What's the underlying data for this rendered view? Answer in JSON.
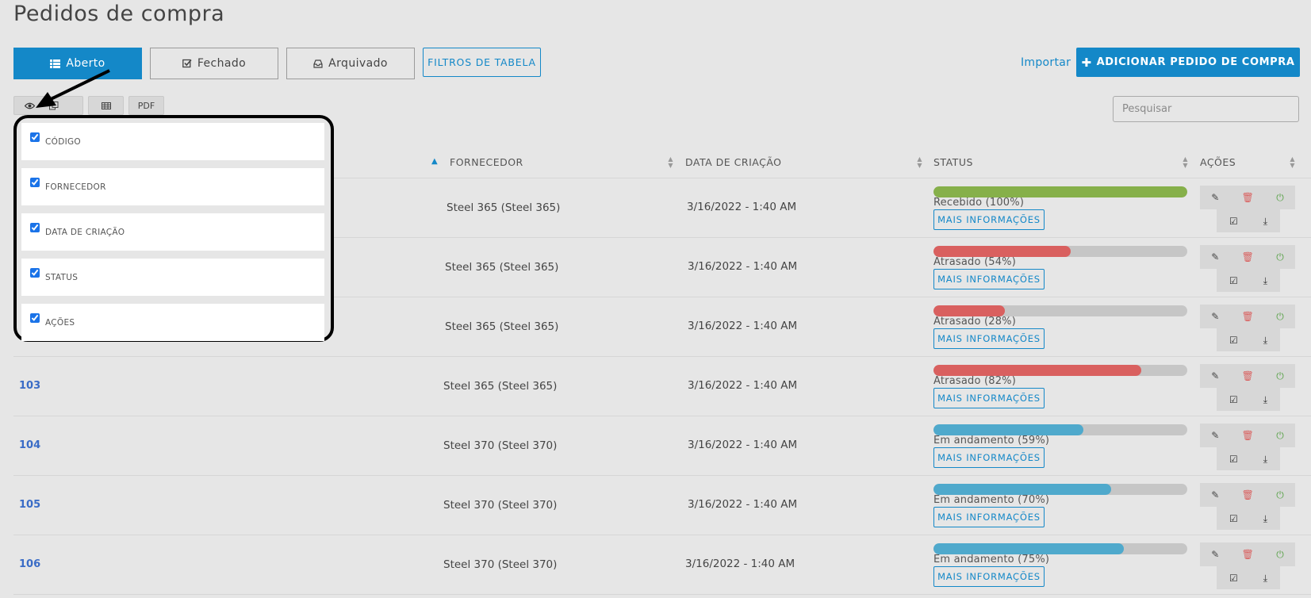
{
  "page": {
    "title": "Pedidos de compra"
  },
  "tabs": [
    {
      "label": "Aberto",
      "icon": "list-icon"
    },
    {
      "label": "Fechado",
      "icon": "check-square-icon"
    },
    {
      "label": "Arquivado",
      "icon": "inbox-icon"
    },
    {
      "label": "FILTROS DE TABELA"
    }
  ],
  "header_actions": {
    "import_label": "Importar",
    "add_label": "ADICIONAR PEDIDO DE COMPRA"
  },
  "toolbar": {
    "pdf_label": "PDF"
  },
  "search": {
    "placeholder": "Pesquisar"
  },
  "columns": {
    "supplier": "FORNECEDOR",
    "created": "DATA DE CRIAÇÃO",
    "status": "STATUS",
    "actions": "AÇÕES"
  },
  "column_chooser": {
    "options": [
      {
        "label": "CÓDIGO",
        "checked": true
      },
      {
        "label": "FORNECEDOR",
        "checked": true
      },
      {
        "label": "DATA DE CRIAÇÃO",
        "checked": true
      },
      {
        "label": "STATUS",
        "checked": true
      },
      {
        "label": "AÇÕES",
        "checked": true
      }
    ]
  },
  "rows": [
    {
      "code": "",
      "supplier": "Steel 365 (Steel 365)",
      "date": "3/16/2022 - 1:40 AM",
      "status": "Recebido (100%)",
      "progress": 100,
      "state": "received",
      "more": "MAIS INFORMAÇÕES"
    },
    {
      "code": "",
      "supplier": "Steel 365 (Steel 365)",
      "date": "3/16/2022 - 1:40 AM",
      "status": "Atrasado (54%)",
      "progress": 54,
      "state": "late",
      "more": "MAIS INFORMAÇÕES"
    },
    {
      "code": "",
      "supplier": "Steel 365 (Steel 365)",
      "date": "3/16/2022 - 1:40 AM",
      "status": "Atrasado (28%)",
      "progress": 28,
      "state": "late",
      "more": "MAIS INFORMAÇÕES"
    },
    {
      "code": "103",
      "supplier": "Steel 365 (Steel 365)",
      "date": "3/16/2022 - 1:40 AM",
      "status": "Atrasado (82%)",
      "progress": 82,
      "state": "late",
      "more": "MAIS INFORMAÇÕES"
    },
    {
      "code": "104",
      "supplier": "Steel 370 (Steel 370)",
      "date": "3/16/2022 - 1:40 AM",
      "status": "Em andamento (59%)",
      "progress": 59,
      "state": "in-progress",
      "more": "MAIS INFORMAÇÕES"
    },
    {
      "code": "105",
      "supplier": "Steel 370 (Steel 370)",
      "date": "3/16/2022 - 1:40 AM",
      "status": "Em andamento (70%)",
      "progress": 70,
      "state": "in-progress",
      "more": "MAIS INFORMAÇÕES"
    },
    {
      "code": "106",
      "supplier": "Steel 370 (Steel 370)",
      "date": "3/16/2022 - 1:40 AM",
      "status": "Em andamento (75%)",
      "progress": 75,
      "state": "in-progress",
      "more": "MAIS INFORMAÇÕES"
    }
  ],
  "colors": {
    "accent": "#1488c8",
    "received": "#86b04a",
    "late": "#d9605f",
    "in_progress": "#4fa9cc",
    "edit_icon": "#444444",
    "delete_icon": "#d9605f",
    "power_icon": "#5aa34a"
  }
}
